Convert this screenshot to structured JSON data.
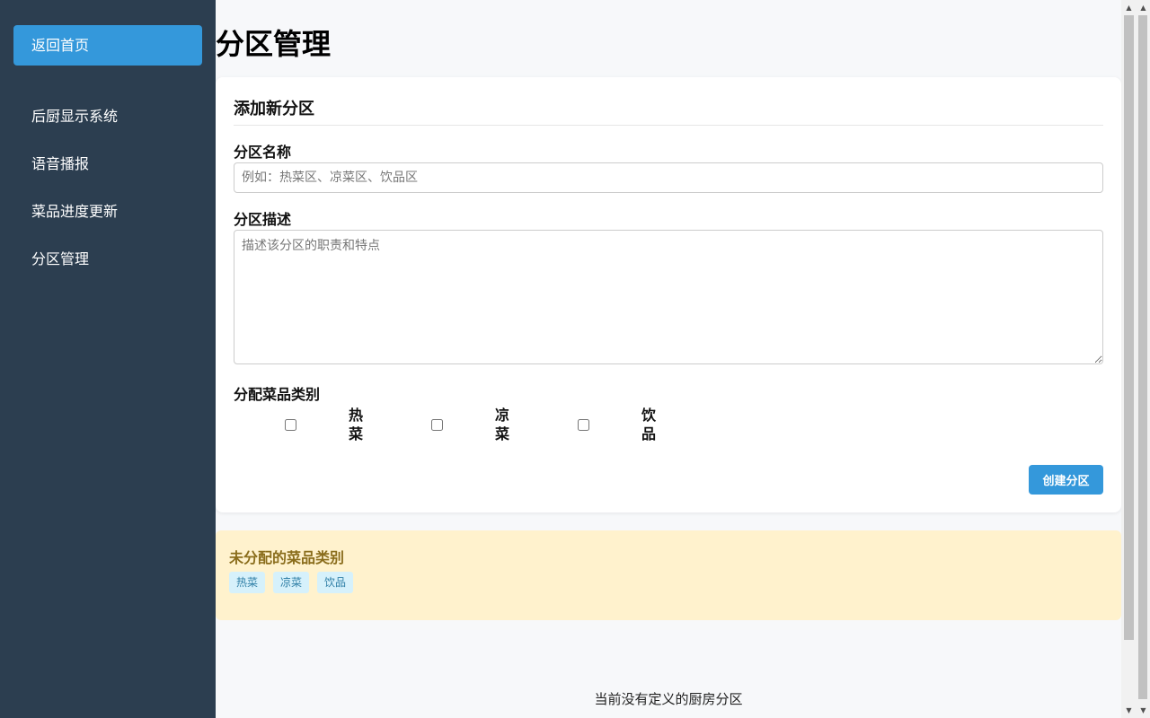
{
  "sidebar": {
    "home_label": "返回首页",
    "items": [
      {
        "label": "后厨显示系统"
      },
      {
        "label": "语音播报"
      },
      {
        "label": "菜品进度更新"
      },
      {
        "label": "分区管理"
      }
    ]
  },
  "page": {
    "title": "分区管理"
  },
  "form": {
    "title": "添加新分区",
    "name_label": "分区名称",
    "name_placeholder": "例如：热菜区、凉菜区、饮品区",
    "name_value": "",
    "desc_label": "分区描述",
    "desc_placeholder": "描述该分区的职责和特点",
    "desc_value": "",
    "categories_label": "分配菜品类别",
    "categories": [
      {
        "label": "热菜",
        "checked": false
      },
      {
        "label": "凉菜",
        "checked": false
      },
      {
        "label": "饮品",
        "checked": false
      }
    ],
    "submit_label": "创建分区"
  },
  "unassigned": {
    "title": "未分配的菜品类别",
    "tags": [
      "热菜",
      "凉菜",
      "饮品"
    ]
  },
  "empty_message": "当前没有定义的厨房分区",
  "colors": {
    "sidebar_bg": "#2c3e50",
    "accent": "#3498db",
    "warning_bg": "#fff2cd",
    "warning_text": "#8a6d1c",
    "tag_bg": "#d6f1fb",
    "tag_text": "#2f7fa6"
  },
  "icons": {
    "scroll_up": "scroll-up-arrow-icon",
    "scroll_down": "scroll-down-arrow-icon"
  }
}
